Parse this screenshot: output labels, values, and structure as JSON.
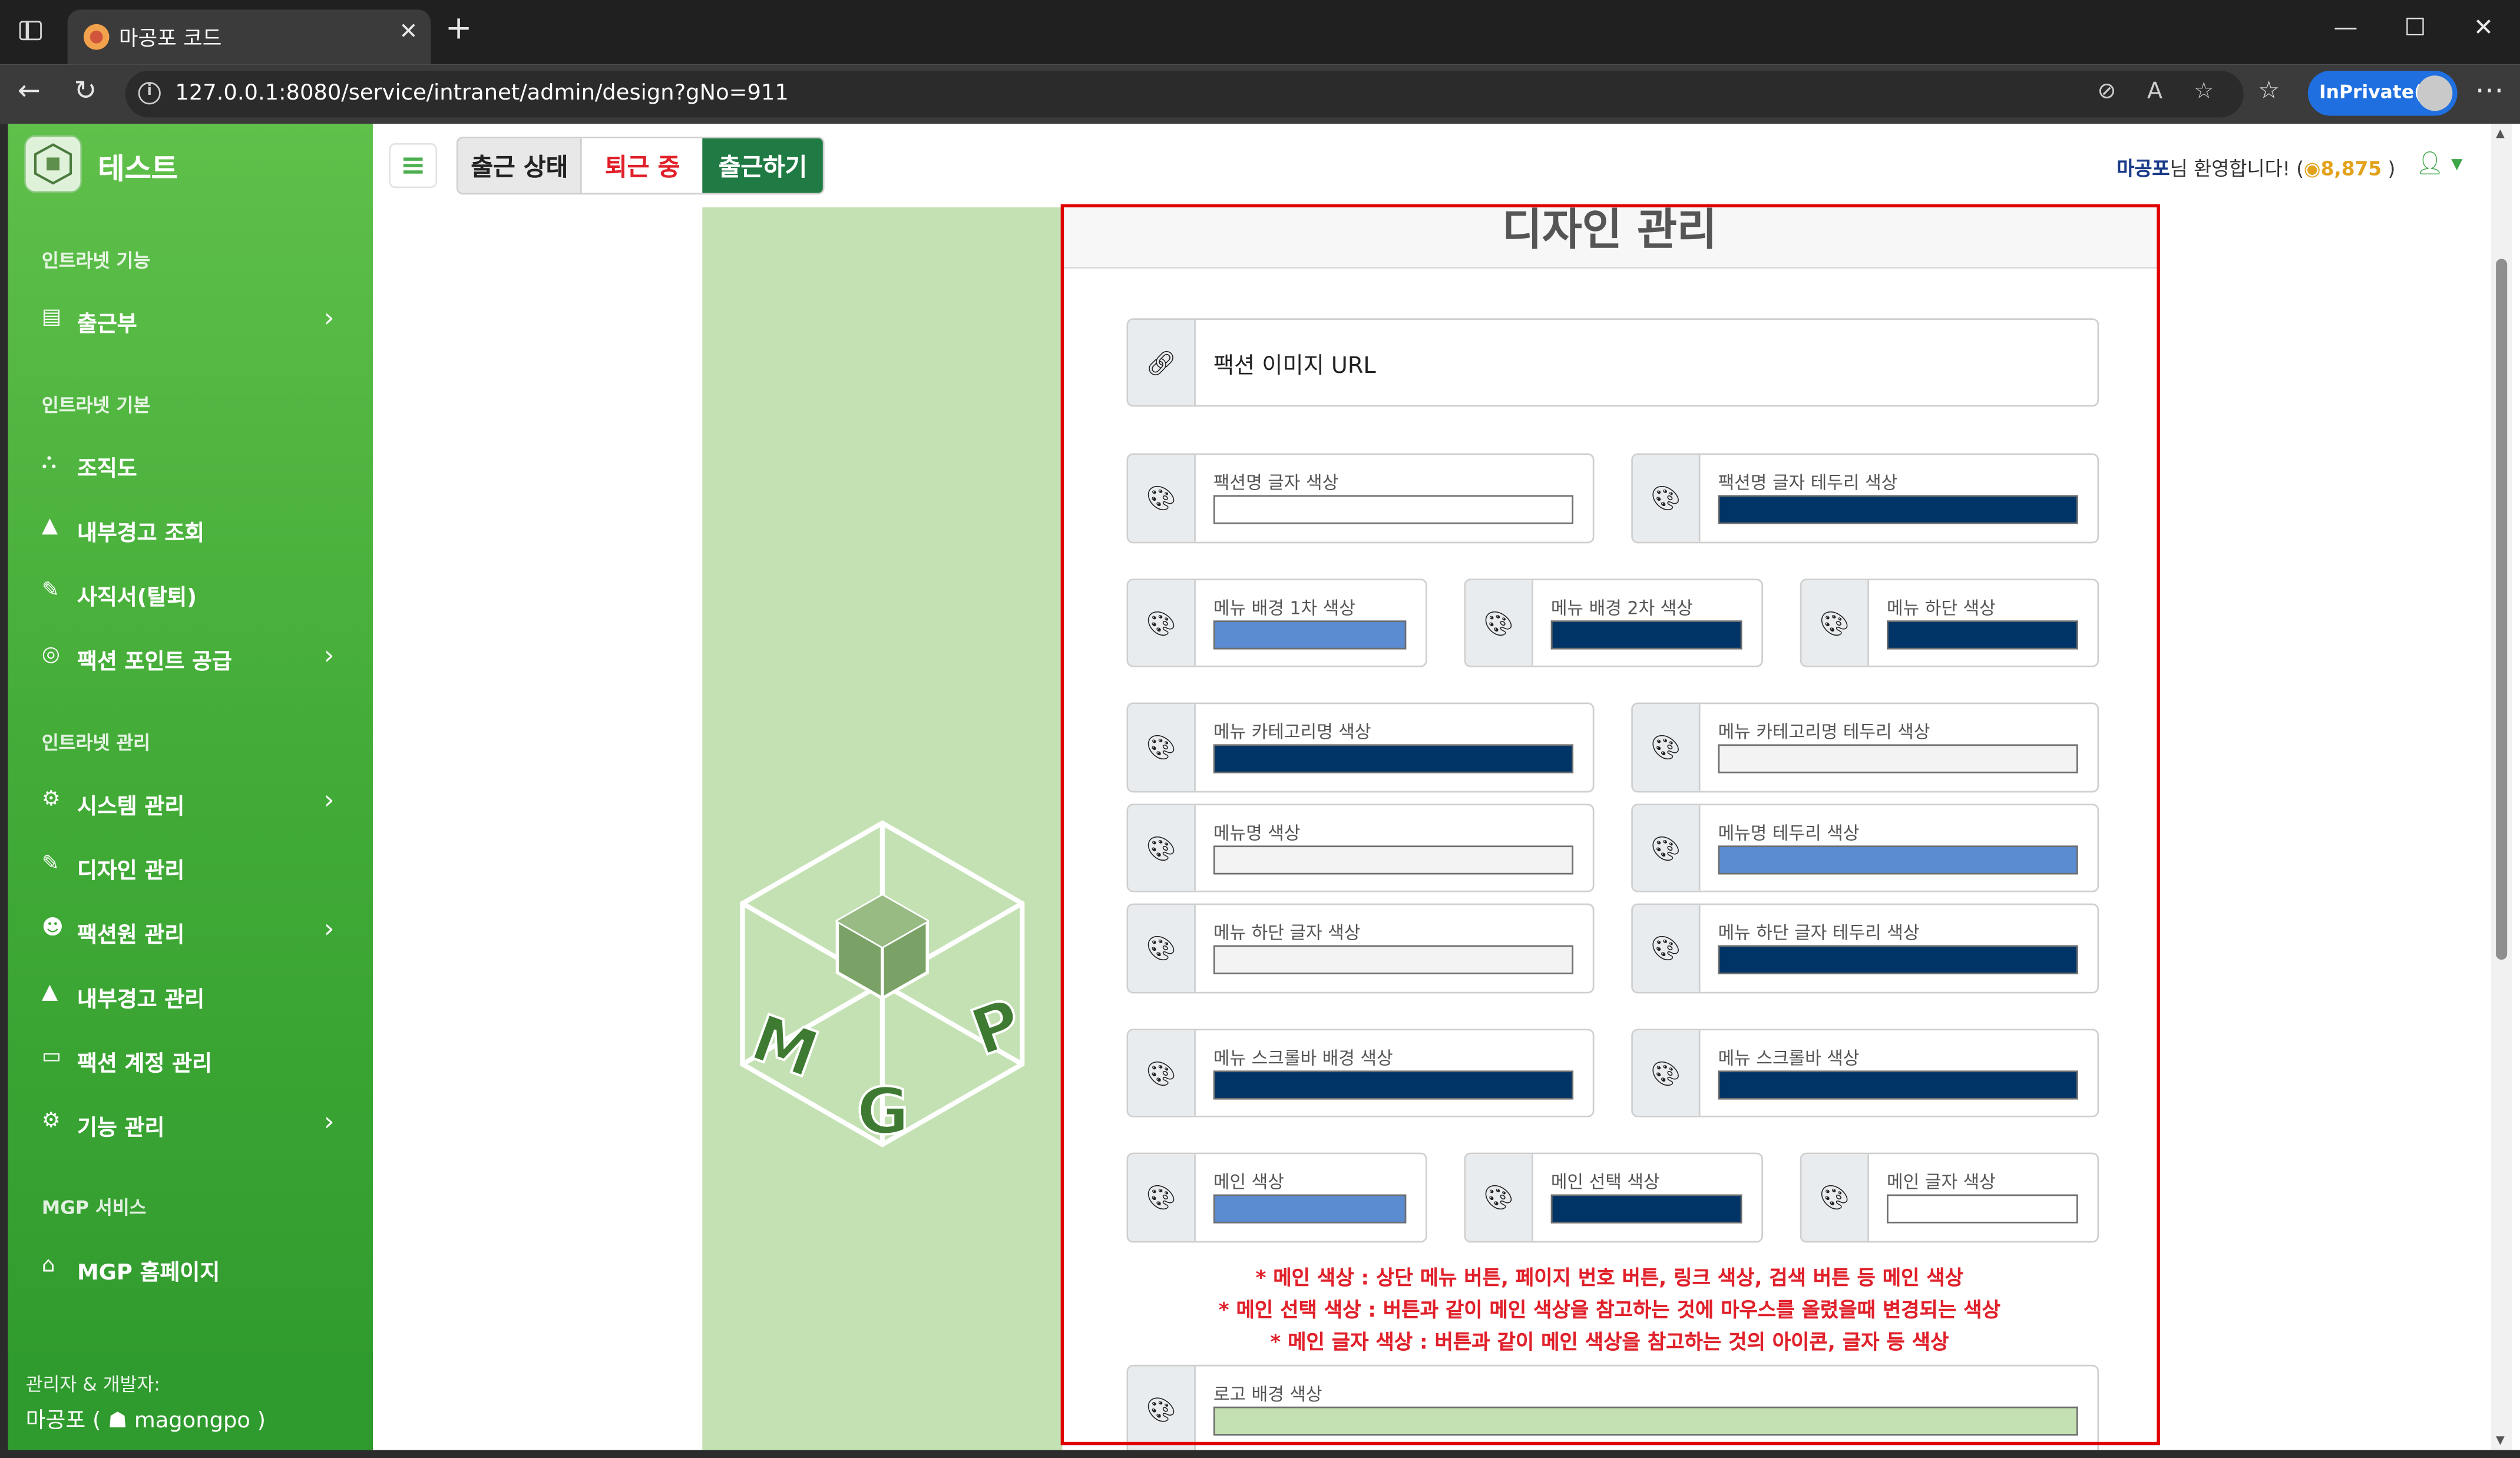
{
  "browser": {
    "tab_title": "마공포 코드",
    "url": "127.0.0.1:8080/service/intranet/admin/design?gNo=911",
    "profile_label": "InPrivate(2)"
  },
  "sidebar": {
    "brand": "테스트",
    "sections": [
      {
        "title": "인트라넷 기능",
        "items": [
          {
            "label": "출근부",
            "icon": "ledger-icon",
            "expandable": true
          }
        ]
      },
      {
        "title": "인트라넷 기본",
        "items": [
          {
            "label": "조직도",
            "icon": "org-chart-icon",
            "expandable": false
          },
          {
            "label": "내부경고 조회",
            "icon": "warning-icon",
            "expandable": false
          },
          {
            "label": "사직서(탈퇴)",
            "icon": "feather-icon",
            "expandable": false
          },
          {
            "label": "팩션 포인트 공급",
            "icon": "coins-icon",
            "expandable": true
          }
        ]
      },
      {
        "title": "인트라넷 관리",
        "items": [
          {
            "label": "시스템 관리",
            "icon": "gear-icon",
            "expandable": true
          },
          {
            "label": "디자인 관리",
            "icon": "brush-icon",
            "expandable": false
          },
          {
            "label": "팩션원 관리",
            "icon": "user-gear-icon",
            "expandable": true
          },
          {
            "label": "내부경고 관리",
            "icon": "warning-icon",
            "expandable": false
          },
          {
            "label": "팩션 계정 관리",
            "icon": "id-card-icon",
            "expandable": false
          },
          {
            "label": "기능 관리",
            "icon": "gears-icon",
            "expandable": true
          }
        ]
      },
      {
        "title": "MGP 서비스",
        "items": [
          {
            "label": "MGP 홈페이지",
            "icon": "home-icon",
            "expandable": false
          }
        ]
      }
    ],
    "footer": {
      "line1": "관리자 & 개발자:",
      "name": "마공포 ( ",
      "discord": "magongpo",
      "close": " )"
    }
  },
  "topbar": {
    "status_label": "출근 상태",
    "off_label": "퇴근 중",
    "checkin_label": "출근하기",
    "welcome_name": "마공포",
    "welcome_text": "님 환영합니다! (",
    "points": "8,875",
    "welcome_close": " )"
  },
  "main": {
    "title": "디자인 관리",
    "image_url_label": "팩션 이미지 URL",
    "fields": {
      "faction_name_color": {
        "label": "팩션명 글자 색상",
        "color": "#ffffff"
      },
      "faction_name_border": {
        "label": "팩션명 글자 테두리 색상",
        "color": "#003366"
      },
      "menu_bg1": {
        "label": "메뉴 배경 1차 색상",
        "color": "#5b8bd0"
      },
      "menu_bg2": {
        "label": "메뉴 배경 2차 색상",
        "color": "#003366"
      },
      "menu_bottom": {
        "label": "메뉴 하단 색상",
        "color": "#003366"
      },
      "menu_category": {
        "label": "메뉴 카테고리명 색상",
        "color": "#003366"
      },
      "menu_category_border": {
        "label": "메뉴 카테고리명 테두리 색상",
        "color": "#f3f3f3"
      },
      "menu_name": {
        "label": "메뉴명 색상",
        "color": "#f3f3f3"
      },
      "menu_name_border": {
        "label": "메뉴명 테두리 색상",
        "color": "#5b8bd0"
      },
      "menu_bottom_text": {
        "label": "메뉴 하단 글자 색상",
        "color": "#f3f3f3"
      },
      "menu_bottom_text_border": {
        "label": "메뉴 하단 글자 테두리 색상",
        "color": "#003366"
      },
      "menu_scrollbar_bg": {
        "label": "메뉴 스크롤바 배경 색상",
        "color": "#003366"
      },
      "menu_scrollbar": {
        "label": "메뉴 스크롤바 색상",
        "color": "#003366"
      },
      "main_color": {
        "label": "메인 색상",
        "color": "#5b8bd0"
      },
      "main_select": {
        "label": "메인 선택 색상",
        "color": "#003366"
      },
      "main_text": {
        "label": "메인 글자 색상",
        "color": "#ffffff"
      },
      "logo_bg": {
        "label": "로고 배경 색상",
        "color": "#c4e1b3"
      }
    },
    "notes": [
      "* 메인 색상 : 상단 메뉴 버튼, 페이지 번호 버튼, 링크 색상, 검색 버튼 등 메인 색상",
      "* 메인 선택 색상 : 버튼과 같이 메인 색상을 참고하는 것에 마우스를 올렸을때 변경되는 색상",
      "* 메인 글자 색상 : 버튼과 같이 메인 색상을 참고하는 것의 아이콘, 글자 등 색상"
    ]
  },
  "colors": {
    "sidebar_green": "#44ad38",
    "accent_dark_green": "#1f7a43",
    "highlight_red": "#e00000"
  }
}
